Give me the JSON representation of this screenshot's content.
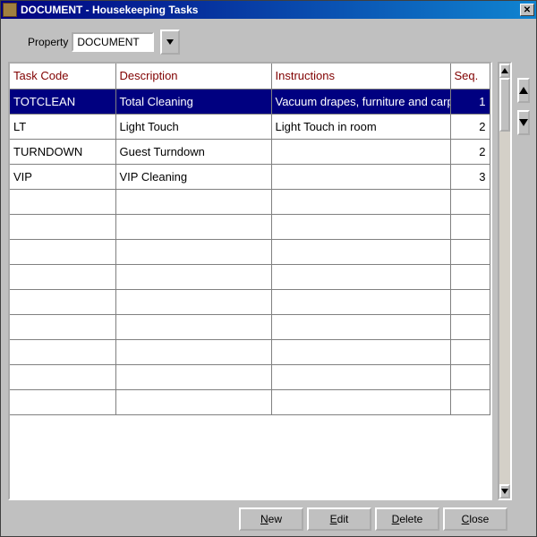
{
  "titlebar": {
    "text": "DOCUMENT - Housekeeping Tasks"
  },
  "property": {
    "label": "Property",
    "value": "DOCUMENT"
  },
  "columns": {
    "task": "Task Code",
    "desc": "Description",
    "instr": "Instructions",
    "seq": "Seq."
  },
  "rows": [
    {
      "task": "TOTCLEAN",
      "desc": "Total Cleaning",
      "instr": "Vacuum drapes, furniture and carpe",
      "seq": "1",
      "selected": true
    },
    {
      "task": "LT",
      "desc": "Light Touch",
      "instr": "Light Touch in room",
      "seq": "2",
      "selected": false
    },
    {
      "task": "TURNDOWN",
      "desc": "Guest Turndown",
      "instr": "",
      "seq": "2",
      "selected": false
    },
    {
      "task": "VIP",
      "desc": "VIP Cleaning",
      "instr": "",
      "seq": "3",
      "selected": false
    }
  ],
  "empty_row_count": 9,
  "buttons": {
    "new": {
      "mn": "N",
      "rest": "ew"
    },
    "edit": {
      "mn": "E",
      "rest": "dit"
    },
    "delete": {
      "mn": "D",
      "rest": "elete"
    },
    "close": {
      "mn": "C",
      "rest": "lose"
    }
  }
}
